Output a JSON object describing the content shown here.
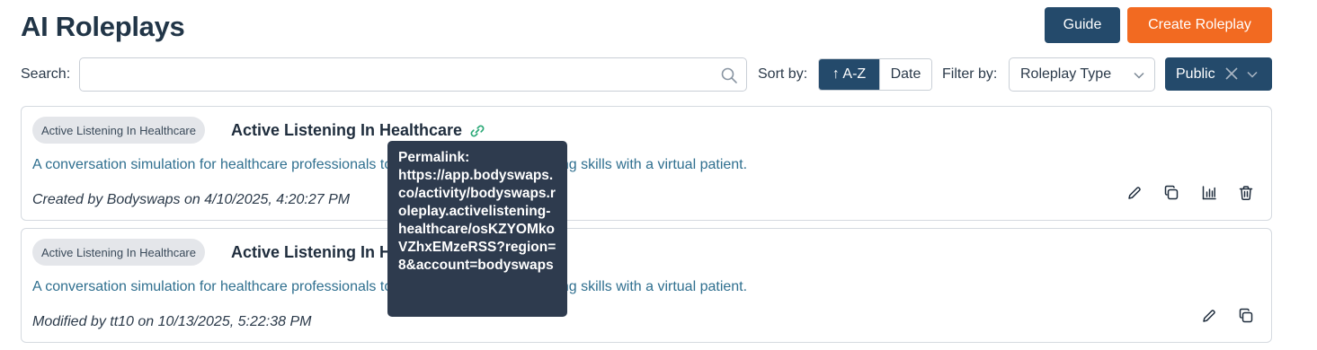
{
  "header": {
    "title": "AI Roleplays",
    "guide_label": "Guide",
    "create_label": "Create Roleplay"
  },
  "toolbar": {
    "search_label": "Search:",
    "search_value": "",
    "sort_label": "Sort by:",
    "sort_options": [
      {
        "label": "↑ A-Z",
        "active": true
      },
      {
        "label": "Date",
        "active": false
      }
    ],
    "filter_label": "Filter by:",
    "filter_select": "Roleplay Type",
    "visibility_chip": "Public"
  },
  "cards": [
    {
      "tag": "Active Listening In Healthcare",
      "title": "Active Listening In Healthcare",
      "description": "A conversation simulation for healthcare professionals to practice your active listening skills with a virtual patient.",
      "meta": "Created by Bodyswaps on 4/10/2025, 4:20:27 PM"
    },
    {
      "tag": "Active Listening In Healthcare",
      "title": "Active Listening In Healthcare",
      "description": "A conversation simulation for healthcare professionals to practice your active listening skills with a virtual patient.",
      "meta": "Modified by tt10 on 10/13/2025, 5:22:38 PM"
    }
  ],
  "tooltip": {
    "label": "Permalink:",
    "url": "https://app.bodyswaps.co/activity/bodyswaps.roleplay.activelistening-healthcare/osKZYOMkoVZhxEMzeRSS?region=8&account=bodyswaps"
  },
  "colors": {
    "primary": "#244a6b",
    "accent": "#f26a21",
    "link_icon": "#2aa876",
    "description": "#2f6f8f"
  }
}
